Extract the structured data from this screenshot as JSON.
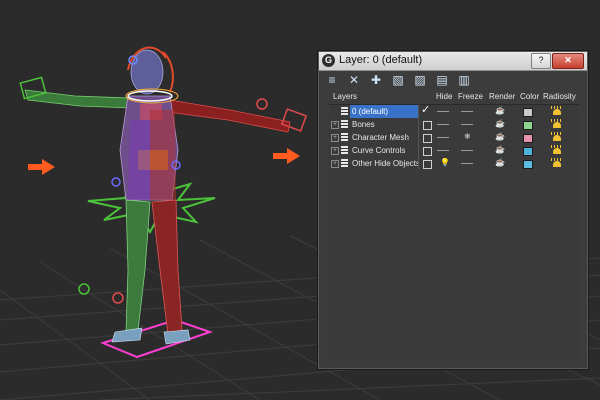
{
  "window": {
    "title": "Layer: 0 (default)",
    "help": "?",
    "close": "✕",
    "app_icon": "G"
  },
  "toolbar": [
    {
      "icon": "new-layer-icon",
      "glyph": "≡"
    },
    {
      "icon": "delete-icon",
      "glyph": "✕"
    },
    {
      "icon": "add-icon",
      "glyph": "✚"
    },
    {
      "icon": "select-objects-icon",
      "glyph": "▧"
    },
    {
      "icon": "highlight-icon",
      "glyph": "▨"
    },
    {
      "icon": "hide-all-icon",
      "glyph": "▤"
    },
    {
      "icon": "freeze-all-icon",
      "glyph": "▥"
    }
  ],
  "columns": {
    "layers": "Layers",
    "hide": "Hide",
    "freeze": "Freeze",
    "render": "Render",
    "color": "Color",
    "radiosity": "Radiosity"
  },
  "layers": [
    {
      "name": "0 (default)",
      "expand": "",
      "color": "#c9c9c9"
    },
    {
      "name": "Bones",
      "expand": "+",
      "color": "#8fd18f"
    },
    {
      "name": "Character Mesh",
      "expand": "+",
      "color": "#e58fb1"
    },
    {
      "name": "Curve Controls",
      "expand": "+",
      "color": "#4fb3d9"
    },
    {
      "name": "Other Hide Objects",
      "expand": "+",
      "color": "#5bbde0"
    }
  ],
  "colors": {
    "accent": "#3973c9",
    "arrow": "#ff5a1f"
  }
}
